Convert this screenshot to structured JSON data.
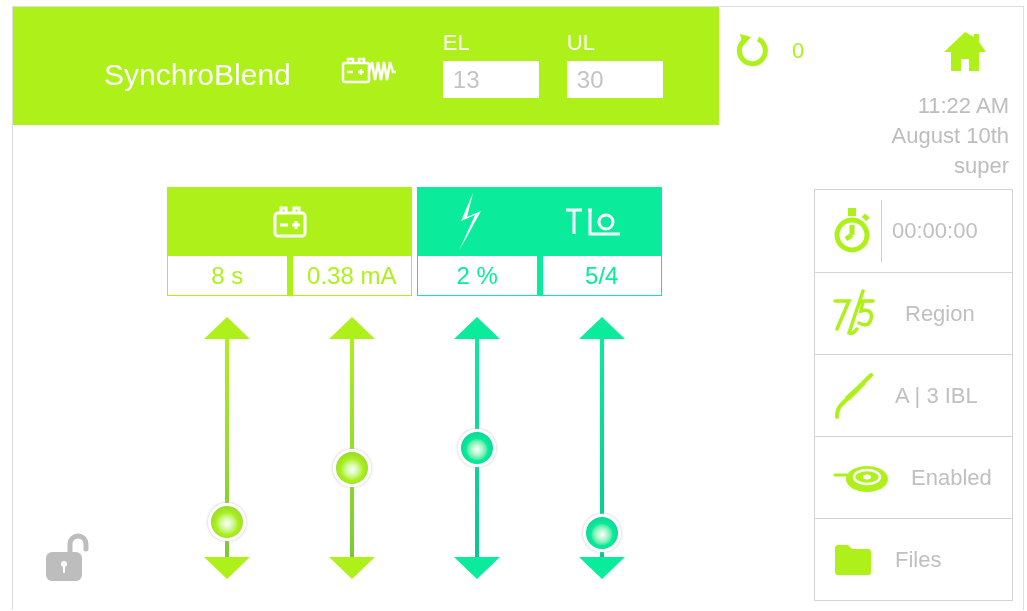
{
  "header": {
    "title": "SynchroBlend",
    "fields": [
      {
        "label": "EL",
        "value": "13"
      },
      {
        "label": "UL",
        "value": "30"
      }
    ]
  },
  "counter": {
    "value": "0"
  },
  "clock": {
    "time": "11:22 AM",
    "date": "August 10th",
    "user": "super"
  },
  "groups": [
    {
      "color": "#aef01a",
      "params": [
        {
          "value": "8 s",
          "level": 0.16
        },
        {
          "value": "0.38 mA",
          "level": 0.41
        }
      ]
    },
    {
      "color": "#0aeb9c",
      "params": [
        {
          "value": "2 %",
          "level": 0.5
        },
        {
          "value": "5/4",
          "level": 0.11
        }
      ]
    }
  ],
  "lock": {
    "locked": false
  },
  "menu": [
    {
      "label": "00:00:00"
    },
    {
      "label": "Region"
    },
    {
      "label": "A | 3 IBL"
    },
    {
      "label": "Enabled"
    },
    {
      "label": "Files"
    }
  ]
}
